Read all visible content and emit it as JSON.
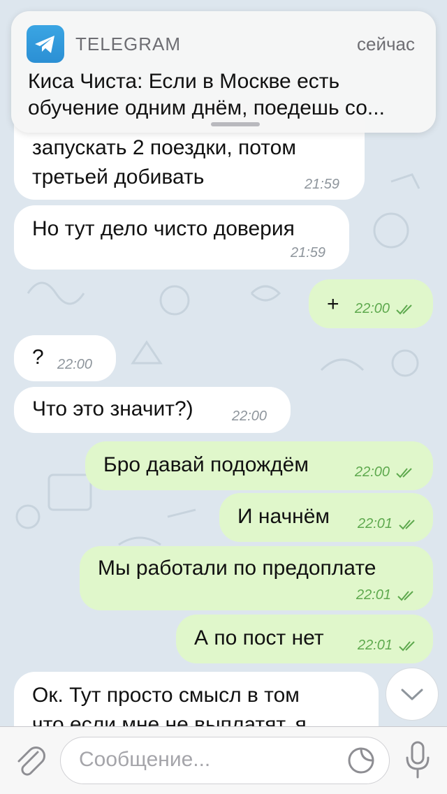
{
  "notification": {
    "app_name": "TELEGRAM",
    "time": "сейчас",
    "line1": "Киса Чиста: Если в Москве есть",
    "line2": "обучение одним днём, поедешь со..."
  },
  "messages": [
    {
      "direction": "in",
      "text_line1": "запускать 2 поездки, потом",
      "text_line2": "третьей добивать",
      "time": "21:59"
    },
    {
      "direction": "in",
      "text": "Но тут дело чисто доверия",
      "time": "21:59"
    },
    {
      "direction": "out",
      "text": "+",
      "time": "22:00",
      "status": "read"
    },
    {
      "direction": "in",
      "text": "?",
      "time": "22:00"
    },
    {
      "direction": "in",
      "text": "Что это значит?)",
      "time": "22:00"
    },
    {
      "direction": "out",
      "text": "Бро давай подождём",
      "time": "22:00",
      "status": "read"
    },
    {
      "direction": "out",
      "text": "И начнём",
      "time": "22:01",
      "status": "read"
    },
    {
      "direction": "out",
      "text": "Мы работали по предоплате",
      "time": "22:01",
      "status": "read"
    },
    {
      "direction": "out",
      "text": "А по пост нет",
      "time": "22:01",
      "status": "read"
    },
    {
      "direction": "in",
      "text_line1": "Ок. Тут просто смысл в том",
      "text_line2": "что если мне не выплатят, я"
    }
  ],
  "input": {
    "placeholder": "Сообщение..."
  },
  "icons": {
    "attach": "paperclip-icon",
    "sticker": "sticker-icon",
    "mic": "microphone-icon",
    "scroll": "chevron-down-icon",
    "app": "telegram-icon"
  },
  "colors": {
    "incoming_bubble": "#ffffff",
    "outgoing_bubble": "#e0f7cb",
    "outgoing_time": "#5ea94e",
    "chat_background": "#dde6ee",
    "telegram_blue": "#2b8fd4"
  }
}
